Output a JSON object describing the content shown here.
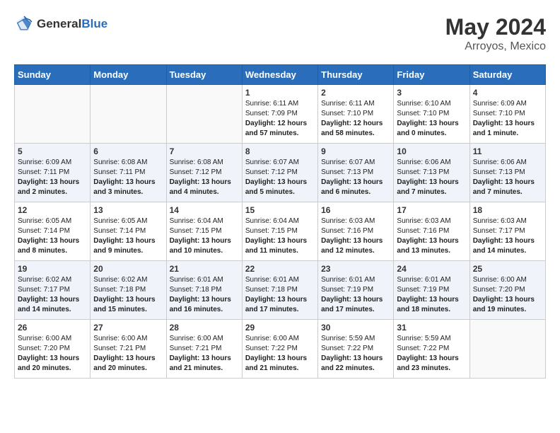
{
  "header": {
    "logo_general": "General",
    "logo_blue": "Blue",
    "main_title": "May 2024",
    "subtitle": "Arroyos, Mexico"
  },
  "days_of_week": [
    "Sunday",
    "Monday",
    "Tuesday",
    "Wednesday",
    "Thursday",
    "Friday",
    "Saturday"
  ],
  "weeks": [
    [
      {
        "day": "",
        "info": ""
      },
      {
        "day": "",
        "info": ""
      },
      {
        "day": "",
        "info": ""
      },
      {
        "day": "1",
        "info": "Sunrise: 6:11 AM\nSunset: 7:09 PM\nDaylight: 12 hours and 57 minutes."
      },
      {
        "day": "2",
        "info": "Sunrise: 6:11 AM\nSunset: 7:10 PM\nDaylight: 12 hours and 58 minutes."
      },
      {
        "day": "3",
        "info": "Sunrise: 6:10 AM\nSunset: 7:10 PM\nDaylight: 13 hours and 0 minutes."
      },
      {
        "day": "4",
        "info": "Sunrise: 6:09 AM\nSunset: 7:10 PM\nDaylight: 13 hours and 1 minute."
      }
    ],
    [
      {
        "day": "5",
        "info": "Sunrise: 6:09 AM\nSunset: 7:11 PM\nDaylight: 13 hours and 2 minutes."
      },
      {
        "day": "6",
        "info": "Sunrise: 6:08 AM\nSunset: 7:11 PM\nDaylight: 13 hours and 3 minutes."
      },
      {
        "day": "7",
        "info": "Sunrise: 6:08 AM\nSunset: 7:12 PM\nDaylight: 13 hours and 4 minutes."
      },
      {
        "day": "8",
        "info": "Sunrise: 6:07 AM\nSunset: 7:12 PM\nDaylight: 13 hours and 5 minutes."
      },
      {
        "day": "9",
        "info": "Sunrise: 6:07 AM\nSunset: 7:13 PM\nDaylight: 13 hours and 6 minutes."
      },
      {
        "day": "10",
        "info": "Sunrise: 6:06 AM\nSunset: 7:13 PM\nDaylight: 13 hours and 7 minutes."
      },
      {
        "day": "11",
        "info": "Sunrise: 6:06 AM\nSunset: 7:13 PM\nDaylight: 13 hours and 7 minutes."
      }
    ],
    [
      {
        "day": "12",
        "info": "Sunrise: 6:05 AM\nSunset: 7:14 PM\nDaylight: 13 hours and 8 minutes."
      },
      {
        "day": "13",
        "info": "Sunrise: 6:05 AM\nSunset: 7:14 PM\nDaylight: 13 hours and 9 minutes."
      },
      {
        "day": "14",
        "info": "Sunrise: 6:04 AM\nSunset: 7:15 PM\nDaylight: 13 hours and 10 minutes."
      },
      {
        "day": "15",
        "info": "Sunrise: 6:04 AM\nSunset: 7:15 PM\nDaylight: 13 hours and 11 minutes."
      },
      {
        "day": "16",
        "info": "Sunrise: 6:03 AM\nSunset: 7:16 PM\nDaylight: 13 hours and 12 minutes."
      },
      {
        "day": "17",
        "info": "Sunrise: 6:03 AM\nSunset: 7:16 PM\nDaylight: 13 hours and 13 minutes."
      },
      {
        "day": "18",
        "info": "Sunrise: 6:03 AM\nSunset: 7:17 PM\nDaylight: 13 hours and 14 minutes."
      }
    ],
    [
      {
        "day": "19",
        "info": "Sunrise: 6:02 AM\nSunset: 7:17 PM\nDaylight: 13 hours and 14 minutes."
      },
      {
        "day": "20",
        "info": "Sunrise: 6:02 AM\nSunset: 7:18 PM\nDaylight: 13 hours and 15 minutes."
      },
      {
        "day": "21",
        "info": "Sunrise: 6:01 AM\nSunset: 7:18 PM\nDaylight: 13 hours and 16 minutes."
      },
      {
        "day": "22",
        "info": "Sunrise: 6:01 AM\nSunset: 7:18 PM\nDaylight: 13 hours and 17 minutes."
      },
      {
        "day": "23",
        "info": "Sunrise: 6:01 AM\nSunset: 7:19 PM\nDaylight: 13 hours and 17 minutes."
      },
      {
        "day": "24",
        "info": "Sunrise: 6:01 AM\nSunset: 7:19 PM\nDaylight: 13 hours and 18 minutes."
      },
      {
        "day": "25",
        "info": "Sunrise: 6:00 AM\nSunset: 7:20 PM\nDaylight: 13 hours and 19 minutes."
      }
    ],
    [
      {
        "day": "26",
        "info": "Sunrise: 6:00 AM\nSunset: 7:20 PM\nDaylight: 13 hours and 20 minutes."
      },
      {
        "day": "27",
        "info": "Sunrise: 6:00 AM\nSunset: 7:21 PM\nDaylight: 13 hours and 20 minutes."
      },
      {
        "day": "28",
        "info": "Sunrise: 6:00 AM\nSunset: 7:21 PM\nDaylight: 13 hours and 21 minutes."
      },
      {
        "day": "29",
        "info": "Sunrise: 6:00 AM\nSunset: 7:22 PM\nDaylight: 13 hours and 21 minutes."
      },
      {
        "day": "30",
        "info": "Sunrise: 5:59 AM\nSunset: 7:22 PM\nDaylight: 13 hours and 22 minutes."
      },
      {
        "day": "31",
        "info": "Sunrise: 5:59 AM\nSunset: 7:22 PM\nDaylight: 13 hours and 23 minutes."
      },
      {
        "day": "",
        "info": ""
      }
    ]
  ]
}
